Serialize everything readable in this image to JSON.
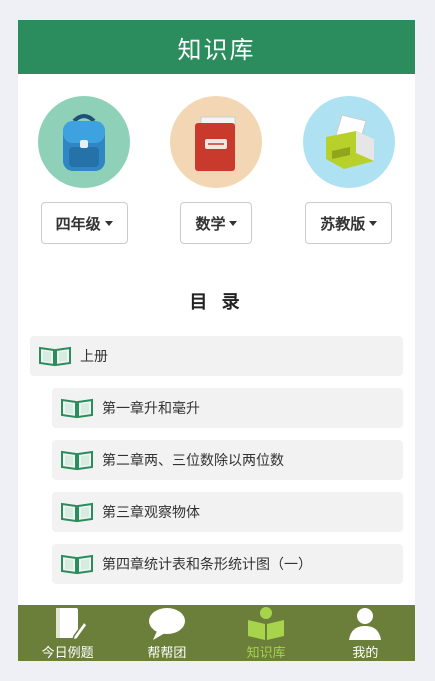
{
  "header": {
    "title": "知识库"
  },
  "pickers": [
    {
      "label": "四年级",
      "icon": "backpack-icon"
    },
    {
      "label": "数学",
      "icon": "red-folder-icon"
    },
    {
      "label": "苏教版",
      "icon": "printer-icon"
    }
  ],
  "toc": {
    "title": "目 录",
    "volume": "上册",
    "chapters": [
      "第一章升和毫升",
      "第二章两、三位数除以两位数",
      "第三章观察物体",
      "第四章统计表和条形统计图（一）"
    ]
  },
  "tabbar": {
    "items": [
      {
        "label": "今日例题",
        "icon": "notebook-pen-icon",
        "active": false
      },
      {
        "label": "帮帮团",
        "icon": "chat-bubble-icon",
        "active": false
      },
      {
        "label": "知识库",
        "icon": "open-book-icon",
        "active": true
      },
      {
        "label": "我的",
        "icon": "user-icon",
        "active": false
      }
    ]
  },
  "colors": {
    "header": "#2b8c5e",
    "tabbar": "#6b7f3a",
    "tab_active": "#a7d44a",
    "book_icon": "#2b8c5e"
  }
}
